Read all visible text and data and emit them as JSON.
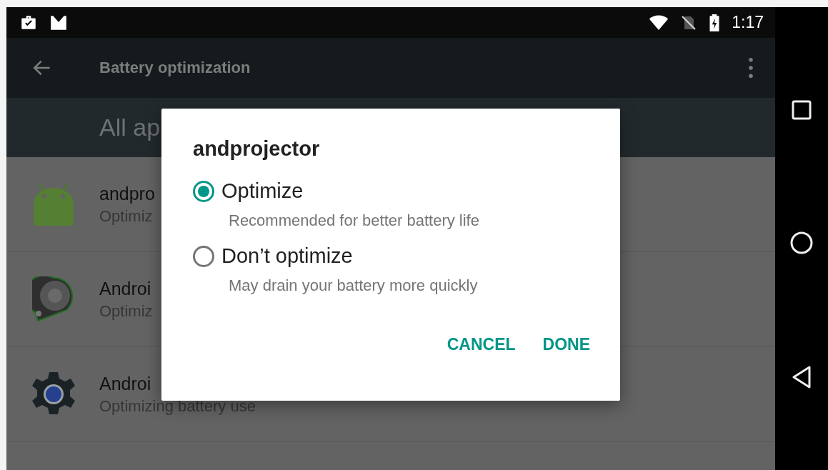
{
  "status_bar": {
    "time": "1:17"
  },
  "toolbar": {
    "title": "Battery optimization"
  },
  "header": {
    "title": "All ap"
  },
  "apps": [
    {
      "name": "andpro",
      "status": "Optimiz",
      "kind": "android"
    },
    {
      "name": "Androi",
      "status": "Optimiz",
      "kind": "projector"
    },
    {
      "name": "Androi",
      "status": "Optimizing battery use",
      "kind": "gear"
    }
  ],
  "dialog": {
    "title": "andprojector",
    "options": [
      {
        "label": "Optimize",
        "description": "Recommended for better battery life",
        "selected": true
      },
      {
        "label": "Don’t optimize",
        "description": "May drain your battery more quickly",
        "selected": false
      }
    ],
    "buttons": [
      "CANCEL",
      "DONE"
    ]
  }
}
